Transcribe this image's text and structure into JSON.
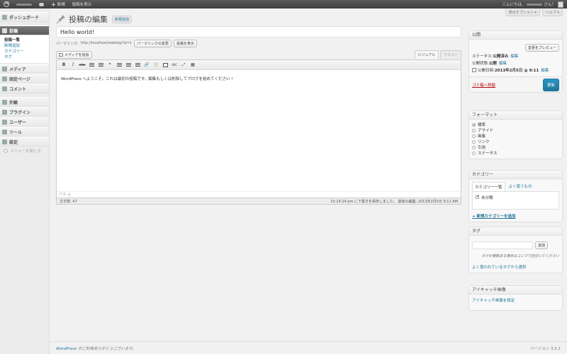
{
  "adminbar": {
    "new_label": "新規",
    "view_post_label": "投稿を表示",
    "greeting_prefix": "こんにちは、",
    "greeting_suffix": "さん！"
  },
  "screen_tabs": {
    "screen_options": "表示オプション ▾",
    "help": "ヘルプ ▾"
  },
  "sidebar": {
    "dashboard": "ダッシュボード",
    "posts": "投稿",
    "posts_sub": [
      "投稿一覧",
      "新規追加",
      "カテゴリー",
      "タグ"
    ],
    "media": "メディア",
    "pages": "固定ページ",
    "comments": "コメント",
    "appearance": "外観",
    "plugins": "プラグイン",
    "users": "ユーザー",
    "tools": "ツール",
    "settings": "設定",
    "collapse": "メニューを閉じる"
  },
  "main": {
    "page_title": "投稿の編集",
    "add_new": "新規追加",
    "post_title": "Hello world!",
    "permalink_label": "パーマリンク:",
    "permalink_url": "http://localhost/weblog/?p=1",
    "change_permalink_btn": "パーマリンクの変更",
    "view_post_btn": "投稿を表示",
    "add_media_btn": "メディアを追加",
    "tab_visual": "ビジュアル",
    "tab_text": "テキスト",
    "toolbar": [
      "B",
      "I",
      "abc",
      "❝",
      "≡",
      "≡",
      "≡",
      "🔗",
      "⛓",
      "▭",
      "ABC",
      "⤢",
      "▦"
    ],
    "content": "WordPress へようこそ。これは最初の投稿です。編集もしくは削除してブログを始めてください !",
    "path": "パス: p",
    "word_count": "文字数: 47",
    "draft_status": "10:14:24 pm に下書きを保存しました。 最後の編集: 2013年2月5日 9:11 AM"
  },
  "publish": {
    "title": "公開",
    "preview_btn": "変更をプレビュー",
    "status_label": "ステータス:",
    "status_value": "公開済み",
    "edit_link": "編集",
    "visibility_label": "公開状態:",
    "visibility_value": "公開",
    "published_on_label": "公開日時:",
    "published_on_value": "2013年2月5日 @ 9:11",
    "trash": "ゴミ箱へ移動",
    "update_btn": "更新"
  },
  "format": {
    "title": "フォーマット",
    "options": [
      "標準",
      "アサイド",
      "画像",
      "リンク",
      "引用",
      "ステータス"
    ],
    "selected": 0
  },
  "categories": {
    "title": "カテゴリー",
    "tab_all": "カテゴリー一覧",
    "tab_popular": "よく使うもの",
    "items": [
      {
        "label": "未分類",
        "checked": true
      }
    ],
    "add_new": "+ 新規カテゴリーを追加"
  },
  "tags": {
    "title": "タグ",
    "add_btn": "追加",
    "help": "タグが複数ある場合はコンマで区切ってください",
    "popular_link": "よく使われているタグから選択"
  },
  "featured": {
    "title": "アイキャッチ画像",
    "set_link": "アイキャッチ画像を設定"
  },
  "footer": {
    "thanks_link": "WordPress",
    "thanks_text": " のご利用ありがとうございます。",
    "version": "バージョン 3.5.1"
  }
}
